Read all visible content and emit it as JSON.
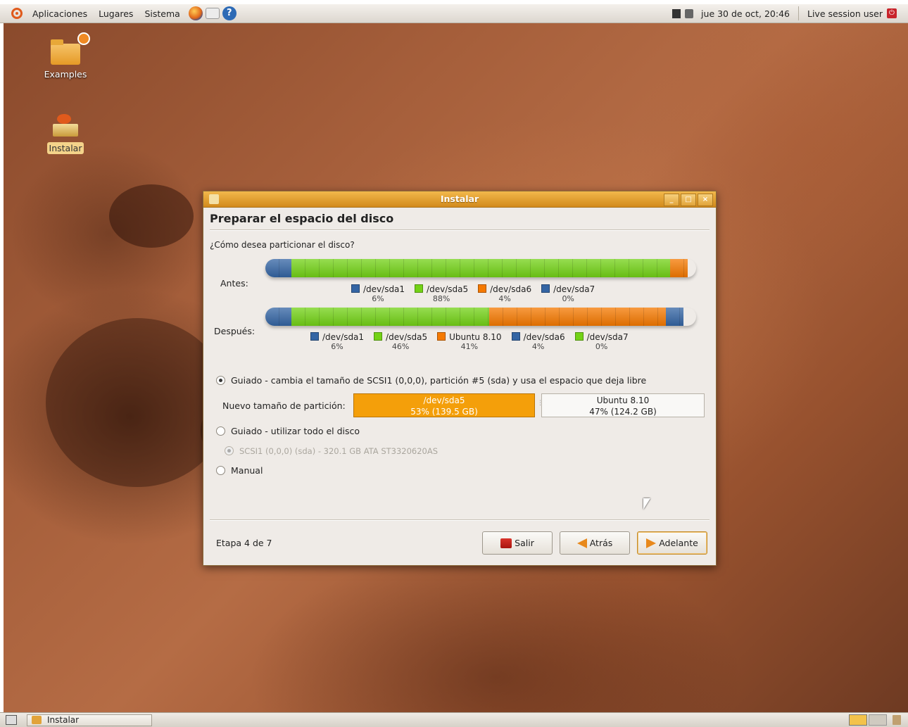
{
  "top_panel": {
    "menus": [
      "Aplicaciones",
      "Lugares",
      "Sistema"
    ],
    "launchers": [
      "firefox-icon",
      "mail-icon",
      "help-icon"
    ],
    "clock": "jue 30 de oct, 20:46",
    "user": "Live session user"
  },
  "desktop": {
    "icons": [
      {
        "label": "Examples",
        "icon": "folder-icon"
      },
      {
        "label": "Instalar",
        "icon": "installer-icon"
      }
    ]
  },
  "dialog": {
    "title": "Instalar",
    "heading": "Preparar el espacio del disco",
    "question": "¿Cómo desea particionar el disco?",
    "before_label": "Antes:",
    "after_label": "Después:",
    "before_partitions": [
      {
        "name": "/dev/sda1",
        "pct": "6%",
        "color": "#3465a4",
        "fraction": 0.06
      },
      {
        "name": "/dev/sda5",
        "pct": "88%",
        "color": "#73d216",
        "fraction": 0.88
      },
      {
        "name": "/dev/sda6",
        "pct": "4%",
        "color": "#f57900",
        "fraction": 0.04
      },
      {
        "name": "/dev/sda7",
        "pct": "0%",
        "color": "#3465a4",
        "fraction": 0.0
      }
    ],
    "after_partitions": [
      {
        "name": "/dev/sda1",
        "pct": "6%",
        "color": "#3465a4",
        "fraction": 0.06
      },
      {
        "name": "/dev/sda5",
        "pct": "46%",
        "color": "#73d216",
        "fraction": 0.46
      },
      {
        "name": "Ubuntu 8.10",
        "pct": "41%",
        "color": "#f57900",
        "fraction": 0.41
      },
      {
        "name": "/dev/sda6",
        "pct": "4%",
        "color": "#3465a4",
        "fraction": 0.04
      },
      {
        "name": "/dev/sda7",
        "pct": "0%",
        "color": "#73d216",
        "fraction": 0.0
      }
    ],
    "options": {
      "guided_resize": "Guiado - cambia el tamaño de SCSI1 (0,0,0), partición #5 (sda) y usa el espacio que deja libre",
      "guided_whole": "Guiado - utilizar todo el disco",
      "disk": "SCSI1 (0,0,0) (sda) - 320.1 GB ATA ST3320620AS",
      "manual": "Manual"
    },
    "resize": {
      "label": "Nuevo tamaño de partición:",
      "left_name": "/dev/sda5",
      "left_size": "53% (139.5 GB)",
      "right_name": "Ubuntu 8.10",
      "right_size": "47% (124.2 GB)"
    },
    "stage": "Etapa 4 de 7",
    "buttons": {
      "quit": "Salir",
      "back": "Atrás",
      "forward": "Adelante"
    }
  },
  "taskbar": {
    "task": "Instalar"
  }
}
